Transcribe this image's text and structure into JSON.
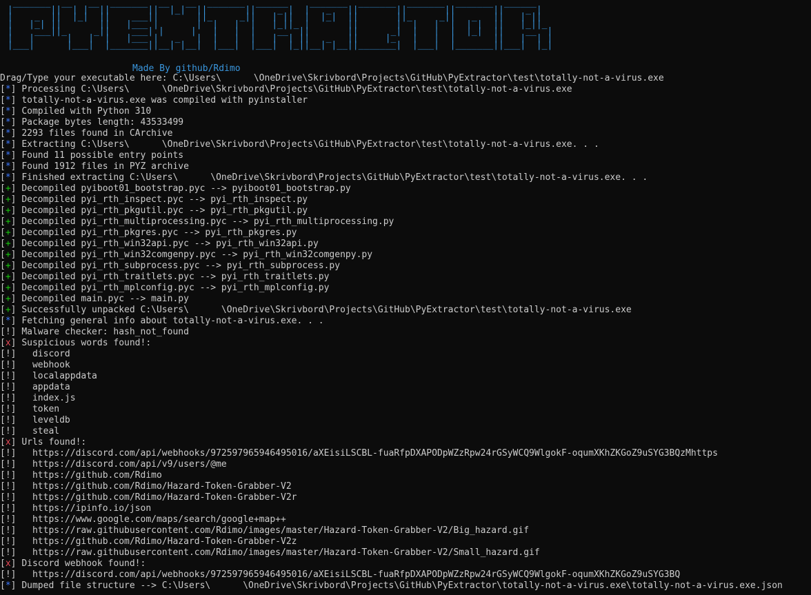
{
  "window": {
    "banner_art": "  _______  __   __  _______  __   __  _______  ______    _______  _______  _______  _______  ______   \n |       ||  | |  ||       ||  |_|  ||       ||    _ |  |   _   ||       ||       ||       ||    _ |  \n |    _  ||  |_|  ||    ___||       ||_     _||   | ||  |  |_|  ||       ||_     _||   _   ||   | ||  \n |   |_| ||       ||   |___ |       |  |   |  |   |_||_ |       ||       |  |   |  |  | |  ||   |_||_ \n |    ___||_     _||    ___| |     |   |   |  |    __  ||       ||      _|  |   |  |  |_|  ||    __  |\n |   |      |   |  |   |___ |   _   |  |   |  |   |  | ||   _   ||     |_   |   |  |       ||   |  | |\n |___|      |___|  |_______||__| |__|  |___|  |___|  |_||__| |__||_______|  |___|  |_______||___|  |_|",
    "made_by": "Made By github/Rdimo"
  },
  "lines": [
    {
      "tag": "",
      "kind": "plain",
      "text": "Drag/Type your executable here: C:\\Users\\      \\OneDrive\\Skrivbord\\Projects\\GitHub\\PyExtractor\\test\\totally-not-a-virus.exe"
    },
    {
      "tag": "*",
      "kind": "info",
      "text": "Processing C:\\Users\\      \\OneDrive\\Skrivbord\\Projects\\GitHub\\PyExtractor\\test\\totally-not-a-virus.exe"
    },
    {
      "tag": "*",
      "kind": "info",
      "text": "totally-not-a-virus.exe was compiled with pyinstaller"
    },
    {
      "tag": "*",
      "kind": "info",
      "text": "Compiled with Python 310"
    },
    {
      "tag": "*",
      "kind": "info",
      "text": "Package bytes length: 43533499"
    },
    {
      "tag": "*",
      "kind": "info",
      "text": "2293 files found in CArchive"
    },
    {
      "tag": "*",
      "kind": "info",
      "text": "Extracting C:\\Users\\      \\OneDrive\\Skrivbord\\Projects\\GitHub\\PyExtractor\\test\\totally-not-a-virus.exe. . ."
    },
    {
      "tag": "*",
      "kind": "info",
      "text": "Found 11 possible entry points"
    },
    {
      "tag": "*",
      "kind": "info",
      "text": "Found 1912 files in PYZ archive"
    },
    {
      "tag": "*",
      "kind": "info",
      "text": "Finished extracting C:\\Users\\      \\OneDrive\\Skrivbord\\Projects\\GitHub\\PyExtractor\\test\\totally-not-a-virus.exe. . ."
    },
    {
      "tag": "+",
      "kind": "ok",
      "text": "Decompiled pyiboot01_bootstrap.pyc --> pyiboot01_bootstrap.py"
    },
    {
      "tag": "+",
      "kind": "ok",
      "text": "Decompiled pyi_rth_inspect.pyc --> pyi_rth_inspect.py"
    },
    {
      "tag": "+",
      "kind": "ok",
      "text": "Decompiled pyi_rth_pkgutil.pyc --> pyi_rth_pkgutil.py"
    },
    {
      "tag": "+",
      "kind": "ok",
      "text": "Decompiled pyi_rth_multiprocessing.pyc --> pyi_rth_multiprocessing.py"
    },
    {
      "tag": "+",
      "kind": "ok",
      "text": "Decompiled pyi_rth_pkgres.pyc --> pyi_rth_pkgres.py"
    },
    {
      "tag": "+",
      "kind": "ok",
      "text": "Decompiled pyi_rth_win32api.pyc --> pyi_rth_win32api.py"
    },
    {
      "tag": "+",
      "kind": "ok",
      "text": "Decompiled pyi_rth_win32comgenpy.pyc --> pyi_rth_win32comgenpy.py"
    },
    {
      "tag": "+",
      "kind": "ok",
      "text": "Decompiled pyi_rth_subprocess.pyc --> pyi_rth_subprocess.py"
    },
    {
      "tag": "+",
      "kind": "ok",
      "text": "Decompiled pyi_rth_traitlets.pyc --> pyi_rth_traitlets.py"
    },
    {
      "tag": "+",
      "kind": "ok",
      "text": "Decompiled pyi_rth_mplconfig.pyc --> pyi_rth_mplconfig.py"
    },
    {
      "tag": "+",
      "kind": "ok",
      "text": "Decompiled main.pyc --> main.py"
    },
    {
      "tag": "+",
      "kind": "ok",
      "text": "Successfully unpacked C:\\Users\\      \\OneDrive\\Skrivbord\\Projects\\GitHub\\PyExtractor\\test\\totally-not-a-virus.exe"
    },
    {
      "tag": "*",
      "kind": "info",
      "text": "Fetching general info about totally-not-a-virus.exe. . ."
    },
    {
      "tag": "!",
      "kind": "warn",
      "text": "Malware checker: hash_not_found"
    },
    {
      "tag": "x",
      "kind": "bad",
      "text": "Suspicious words found!:"
    },
    {
      "tag": "!",
      "kind": "warn",
      "text": "  discord"
    },
    {
      "tag": "!",
      "kind": "warn",
      "text": "  webhook"
    },
    {
      "tag": "!",
      "kind": "warn",
      "text": "  localappdata"
    },
    {
      "tag": "!",
      "kind": "warn",
      "text": "  appdata"
    },
    {
      "tag": "!",
      "kind": "warn",
      "text": "  index.js"
    },
    {
      "tag": "!",
      "kind": "warn",
      "text": "  token"
    },
    {
      "tag": "!",
      "kind": "warn",
      "text": "  leveldb"
    },
    {
      "tag": "!",
      "kind": "warn",
      "text": "  steal"
    },
    {
      "tag": "x",
      "kind": "bad",
      "text": "Urls found!:"
    },
    {
      "tag": "!",
      "kind": "warn",
      "text": "  https://discord.com/api/webhooks/972597965946495016/aXEisiLSCBL-fuaRfpDXAPODpWZzRpw24rGSyWCQ9WlgokF-oqumXKhZKGoZ9uSYG3BQzMhttps"
    },
    {
      "tag": "!",
      "kind": "warn",
      "text": "  https://discord.com/api/v9/users/@me"
    },
    {
      "tag": "!",
      "kind": "warn",
      "text": "  https://github.com/Rdimo"
    },
    {
      "tag": "!",
      "kind": "warn",
      "text": "  https://github.com/Rdimo/Hazard-Token-Grabber-V2"
    },
    {
      "tag": "!",
      "kind": "warn",
      "text": "  https://github.com/Rdimo/Hazard-Token-Grabber-V2r"
    },
    {
      "tag": "!",
      "kind": "warn",
      "text": "  https://ipinfo.io/json"
    },
    {
      "tag": "!",
      "kind": "warn",
      "text": "  https://www.google.com/maps/search/google+map++"
    },
    {
      "tag": "!",
      "kind": "warn",
      "text": "  https://raw.githubusercontent.com/Rdimo/images/master/Hazard-Token-Grabber-V2/Big_hazard.gif"
    },
    {
      "tag": "!",
      "kind": "warn",
      "text": "  https://github.com/Rdimo/Hazard-Token-Grabber-V2z"
    },
    {
      "tag": "!",
      "kind": "warn",
      "text": "  https://raw.githubusercontent.com/Rdimo/images/master/Hazard-Token-Grabber-V2/Small_hazard.gif"
    },
    {
      "tag": "x",
      "kind": "bad",
      "text": "Discord webhook found!:"
    },
    {
      "tag": "!",
      "kind": "warn",
      "text": "  https://discord.com/api/webhooks/972597965946495016/aXEisiLSCBL-fuaRfpDXAPODpWZzRpw24rGSyWCQ9WlgokF-oqumXKhZKGoZ9uSYG3BQ"
    },
    {
      "tag": "*",
      "kind": "info",
      "text": "Dumped file structure --> C:\\Users\\      \\OneDrive\\Skrivbord\\Projects\\GitHub\\PyExtractor\\totally-not-a-virus.exe\\totally-not-a-virus.exe.json"
    }
  ],
  "colors": {
    "background": "#0c0c0c",
    "text": "#cccccc",
    "info": "#3b78ff",
    "ok": "#16c60c",
    "bad": "#e74856",
    "banner": "#3a96dd"
  }
}
